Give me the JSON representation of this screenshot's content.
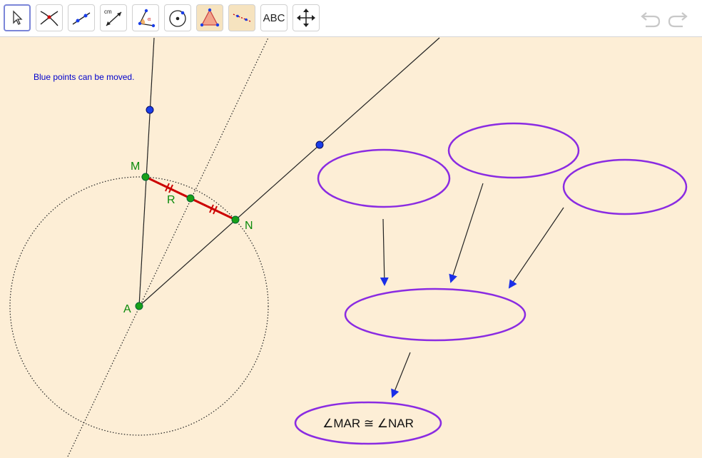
{
  "toolbar": {
    "tools": [
      {
        "name": "move-tool",
        "label": ""
      },
      {
        "name": "point-tool",
        "label": ""
      },
      {
        "name": "line-tool",
        "label": ""
      },
      {
        "name": "measure-tool",
        "label": "cm"
      },
      {
        "name": "angle-tool",
        "label": "α"
      },
      {
        "name": "circle-tool",
        "label": ""
      },
      {
        "name": "polygon-tool",
        "label": ""
      },
      {
        "name": "reflect-tool",
        "label": ""
      },
      {
        "name": "text-tool",
        "label": "ABC"
      },
      {
        "name": "move-view-tool",
        "label": ""
      }
    ]
  },
  "canvas": {
    "note": "Blue points can be moved.",
    "points": {
      "M": "M",
      "R": "R",
      "N": "N",
      "A": "A"
    },
    "result_text": "∠MAR ≅ ∠NAR"
  },
  "colors": {
    "background": "#fdeed6",
    "ellipse": "#8a2be2",
    "segment": "#cc0000",
    "green_point": "#18a018",
    "blue_point": "#1a3ee8",
    "arrow": "#1a2ee8"
  }
}
